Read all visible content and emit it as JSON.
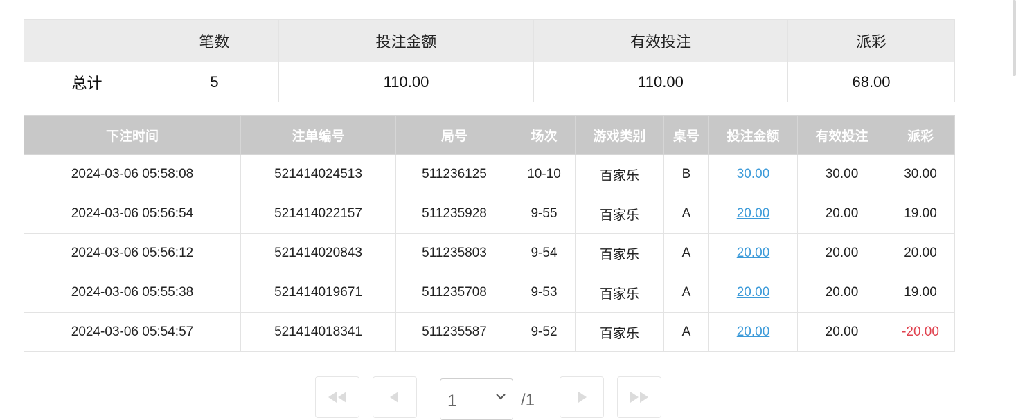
{
  "summary": {
    "headers": [
      "",
      "笔数",
      "投注金额",
      "有效投注",
      "派彩"
    ],
    "row": [
      "总计",
      "5",
      "110.00",
      "110.00",
      "68.00"
    ]
  },
  "detail": {
    "headers": [
      "下注时间",
      "注单编号",
      "局号",
      "场次",
      "游戏类别",
      "桌号",
      "投注金额",
      "有效投注",
      "派彩"
    ],
    "rows": [
      [
        "2024-03-06 05:58:08",
        "521414024513",
        "511236125",
        "10-10",
        "百家乐",
        "B",
        "30.00",
        "30.00",
        "30.00"
      ],
      [
        "2024-03-06 05:56:54",
        "521414022157",
        "511235928",
        "9-55",
        "百家乐",
        "A",
        "20.00",
        "20.00",
        "19.00"
      ],
      [
        "2024-03-06 05:56:12",
        "521414020843",
        "511235803",
        "9-54",
        "百家乐",
        "A",
        "20.00",
        "20.00",
        "20.00"
      ],
      [
        "2024-03-06 05:55:38",
        "521414019671",
        "511235708",
        "9-53",
        "百家乐",
        "A",
        "20.00",
        "20.00",
        "19.00"
      ],
      [
        "2024-03-06 05:54:57",
        "521414018341",
        "511235587",
        "9-52",
        "百家乐",
        "A",
        "20.00",
        "20.00",
        "-20.00"
      ]
    ]
  },
  "pager": {
    "current_page": "1",
    "total_pages": "/1",
    "icons": [
      "first-page-icon",
      "prev-page-icon",
      "next-page-icon",
      "last-page-icon"
    ]
  },
  "colors": {
    "link": "#3b9ad9",
    "negative": "#e0424f",
    "header_bg": "#c8c8c8",
    "summary_header_bg": "#ebebeb"
  }
}
